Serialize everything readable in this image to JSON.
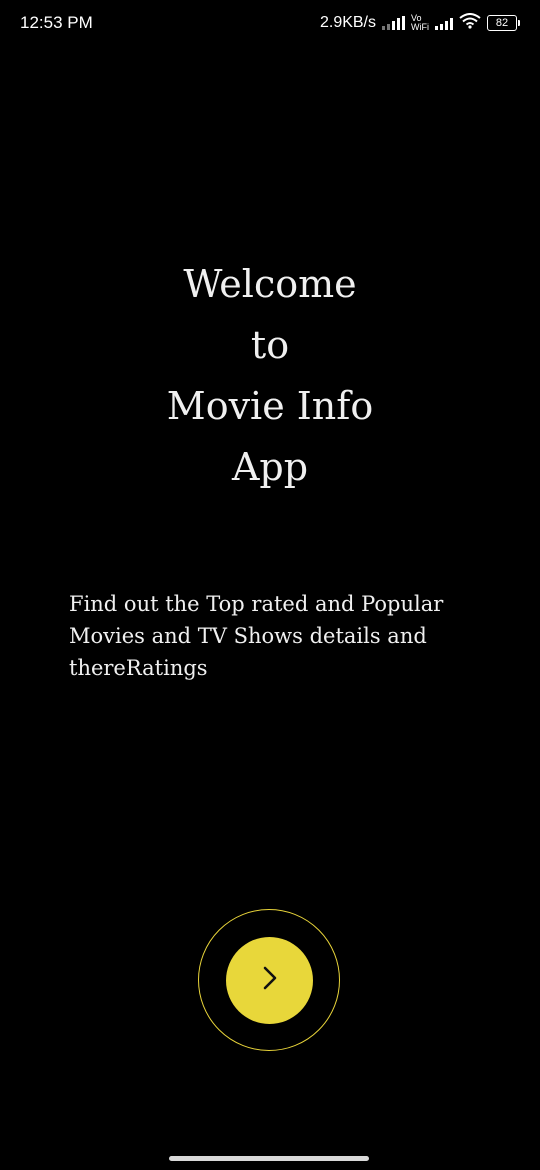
{
  "status_bar": {
    "time": "12:53 PM",
    "network_speed": "2.9KB/s",
    "vowifi_top": "Vo",
    "vowifi_bottom": "WiFi",
    "battery_level": "82",
    "icons": [
      "signal-icon",
      "vowifi-icon",
      "signal-icon",
      "wifi-icon",
      "battery-icon"
    ]
  },
  "welcome": {
    "lines": [
      "Welcome",
      "to",
      "Movie Info",
      "App"
    ]
  },
  "description": "Find out the Top rated and Popular Movies and TV Shows details and thereRatings",
  "next_button": {
    "icon": "chevron-right-icon",
    "accent_color": "#e8d73a"
  },
  "colors": {
    "background": "#000000",
    "text": "#f0f0f0",
    "accent": "#e8d73a"
  }
}
